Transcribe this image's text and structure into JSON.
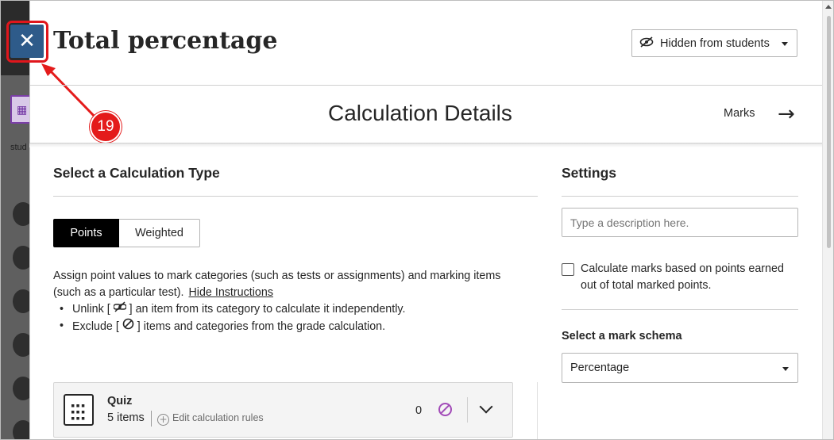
{
  "background": {
    "side_label": "stud"
  },
  "header": {
    "title": "Total percentage",
    "visibility": {
      "label": "Hidden from students",
      "icon": "eye-slash-icon"
    }
  },
  "callout": {
    "number": "19",
    "color": "#e41b1b"
  },
  "nav": {
    "section_title": "Calculation Details",
    "next_label": "Marks",
    "next_icon": "arrow-right-icon"
  },
  "calculation": {
    "heading": "Select a Calculation Type",
    "types": [
      {
        "label": "Points",
        "selected": true
      },
      {
        "label": "Weighted",
        "selected": false
      }
    ],
    "instructions": {
      "text": "Assign point values to mark categories (such as tests or assignments) and marking items (such as a particular test).",
      "hide_link": "Hide Instructions",
      "bullets": [
        {
          "prefix": "Unlink [",
          "icon": "unlink-icon",
          "suffix": "] an item from its category to calculate it independently."
        },
        {
          "prefix": "Exclude [",
          "icon": "exclude-icon",
          "suffix": "] items and categories from the grade calculation."
        }
      ]
    },
    "items": [
      {
        "name": "Quiz",
        "count": "5 items",
        "edit_label": "Edit calculation rules",
        "points": "0"
      }
    ]
  },
  "settings": {
    "heading": "Settings",
    "description_placeholder": "Type a description here.",
    "checkbox_label": "Calculate marks based on points earned out of total marked points.",
    "checkbox_checked": false,
    "schema_label": "Select a mark schema",
    "schema_value": "Percentage"
  },
  "colors": {
    "close_button": "#2e5b8a",
    "accent_purple": "#a24bb8",
    "active_segment": "#000000"
  }
}
